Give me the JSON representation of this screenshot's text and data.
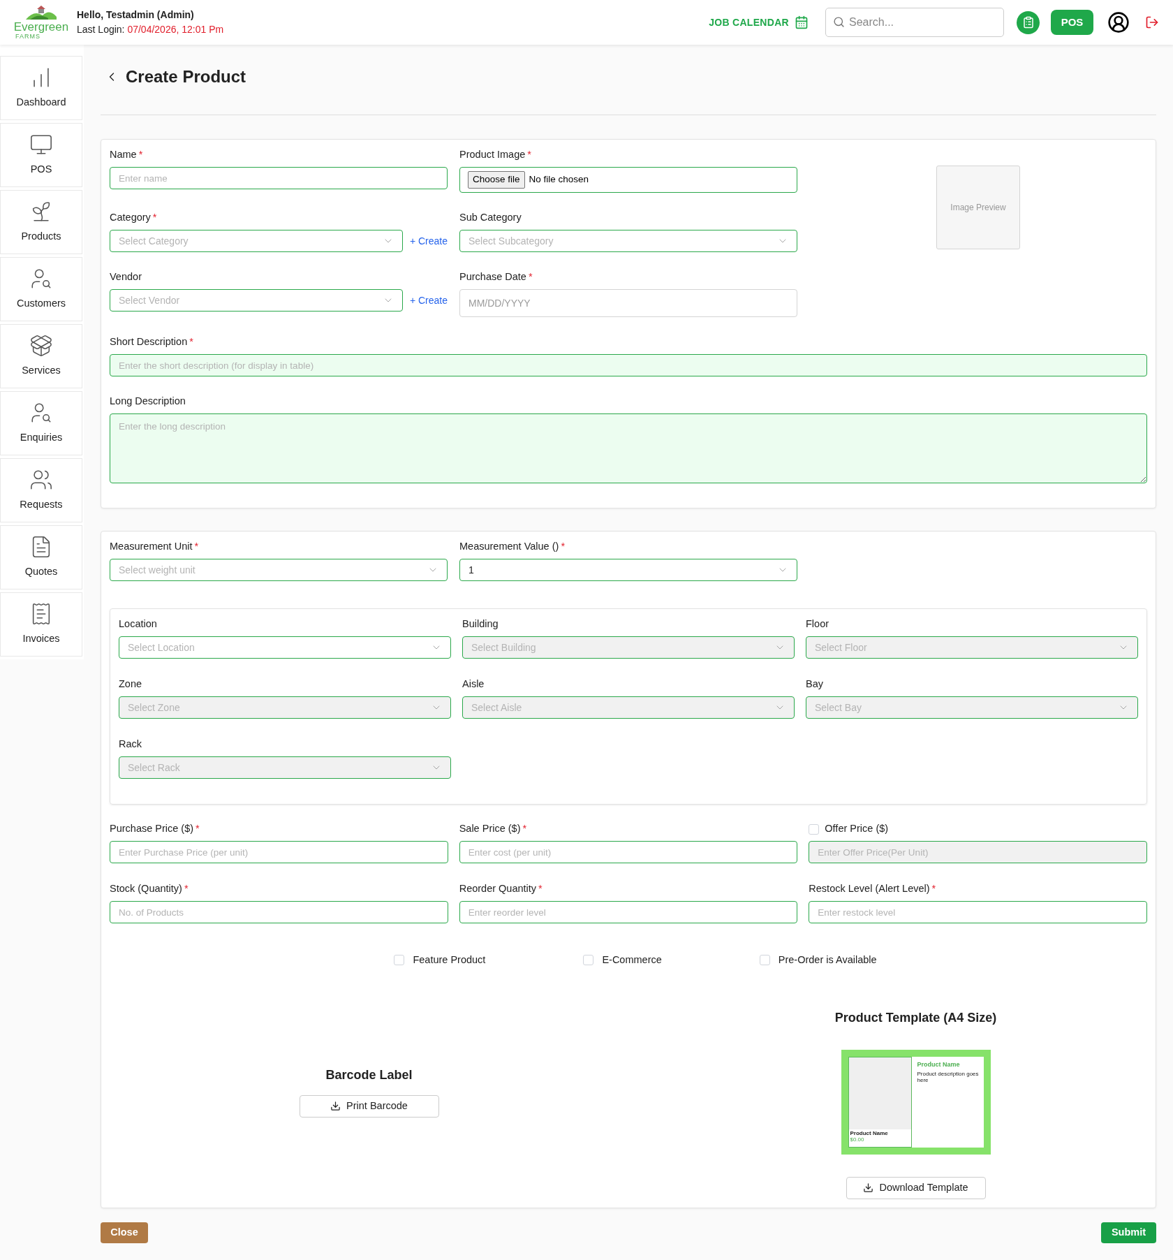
{
  "header": {
    "logo": {
      "name": "Evergreen",
      "sub": "FARMS"
    },
    "greeting": "Hello, Testadmin (Admin)",
    "last_login_label": "Last Login:",
    "last_login_value": "07/04/2026, 12:01 Pm",
    "job_calendar": "JOB CALENDAR",
    "search": {
      "placeholder": "Search..."
    },
    "pos_button": "POS"
  },
  "sidebar": {
    "items": [
      {
        "label": "Dashboard"
      },
      {
        "label": "POS"
      },
      {
        "label": "Products"
      },
      {
        "label": "Customers"
      },
      {
        "label": "Services"
      },
      {
        "label": "Enquiries"
      },
      {
        "label": "Requests"
      },
      {
        "label": "Quotes"
      },
      {
        "label": "Invoices"
      }
    ]
  },
  "page": {
    "title": "Create Product"
  },
  "details": {
    "fields": [
      {
        "kind": "text",
        "label": "Name",
        "required": true,
        "placeholder": "Enter name"
      },
      {
        "kind": "file",
        "label": "Product Image",
        "required": true,
        "button": "Choose file",
        "value": "No file chosen"
      },
      {
        "kind": "select",
        "label": "Category",
        "required": true,
        "placeholder": "Select Category",
        "create_link": "+ Create"
      },
      {
        "kind": "select",
        "label": "Sub Category",
        "required": false,
        "placeholder": "Select Subcategory"
      },
      {
        "kind": "select",
        "label": "Vendor",
        "required": false,
        "placeholder": "Select Vendor",
        "create_link": "+ Create"
      },
      {
        "kind": "date",
        "label": "Purchase Date",
        "required": true,
        "placeholder": "MM/DD/YYYY"
      }
    ],
    "image_preview": "Image Preview",
    "descriptions": [
      {
        "kind": "text",
        "label": "Short Description",
        "required": true,
        "placeholder": "Enter the short description (for display in table)"
      },
      {
        "kind": "textarea",
        "label": "Long Description",
        "required": false,
        "placeholder": "Enter the long description"
      }
    ]
  },
  "inventory": {
    "measurement": [
      {
        "kind": "select",
        "label": "Measurement Unit",
        "required": true,
        "placeholder": "Select weight unit"
      },
      {
        "kind": "select",
        "label": "Measurement Value ()",
        "required": true,
        "value": "1"
      }
    ],
    "location": [
      {
        "kind": "select",
        "label": "Location",
        "required": false,
        "placeholder": "Select Location",
        "disabled": false
      },
      {
        "kind": "select",
        "label": "Building",
        "required": false,
        "placeholder": "Select Building",
        "disabled": true
      },
      {
        "kind": "select",
        "label": "Floor",
        "required": false,
        "placeholder": "Select Floor",
        "disabled": true
      },
      {
        "kind": "select",
        "label": "Zone",
        "required": false,
        "placeholder": "Select Zone",
        "disabled": true
      },
      {
        "kind": "select",
        "label": "Aisle",
        "required": false,
        "placeholder": "Select Aisle",
        "disabled": true
      },
      {
        "kind": "select",
        "label": "Bay",
        "required": false,
        "placeholder": "Select Bay",
        "disabled": true
      },
      {
        "kind": "select",
        "label": "Rack",
        "required": false,
        "placeholder": "Select Rack",
        "disabled": true
      }
    ],
    "pricing": [
      {
        "kind": "text",
        "label": "Purchase Price ($)",
        "required": true,
        "placeholder": "Enter Purchase Price (per unit)"
      },
      {
        "kind": "text",
        "label": "Sale Price ($)",
        "required": true,
        "placeholder": "Enter cost (per unit)"
      },
      {
        "kind": "text",
        "label": "Offer Price ($)",
        "required": false,
        "placeholder": "Enter Offer Price(Per Unit)",
        "disabled": true,
        "toggle_checked": false
      },
      {
        "kind": "text",
        "label": "Stock (Quantity)",
        "required": true,
        "placeholder": "No. of Products"
      },
      {
        "kind": "text",
        "label": "Reorder Quantity",
        "required": true,
        "placeholder": "Enter reorder level"
      },
      {
        "kind": "text",
        "label": "Restock Level (Alert Level)",
        "required": true,
        "placeholder": "Enter restock level"
      }
    ],
    "options": [
      {
        "label": "Feature Product",
        "checked": false
      },
      {
        "label": "E-Commerce",
        "checked": false
      },
      {
        "label": "Pre-Order is Available",
        "checked": false
      }
    ],
    "barcode": {
      "title": "Barcode Label",
      "button": "Print Barcode"
    },
    "template": {
      "title": "Product Template (A4 Size)",
      "preview": {
        "heading": "Product Name",
        "description": "Product description goes here",
        "card_name": "Product Name",
        "card_price": "$0.00"
      },
      "button": "Download Template"
    }
  },
  "footer": {
    "close": "Close",
    "submit": "Submit"
  },
  "required_mark": "*"
}
